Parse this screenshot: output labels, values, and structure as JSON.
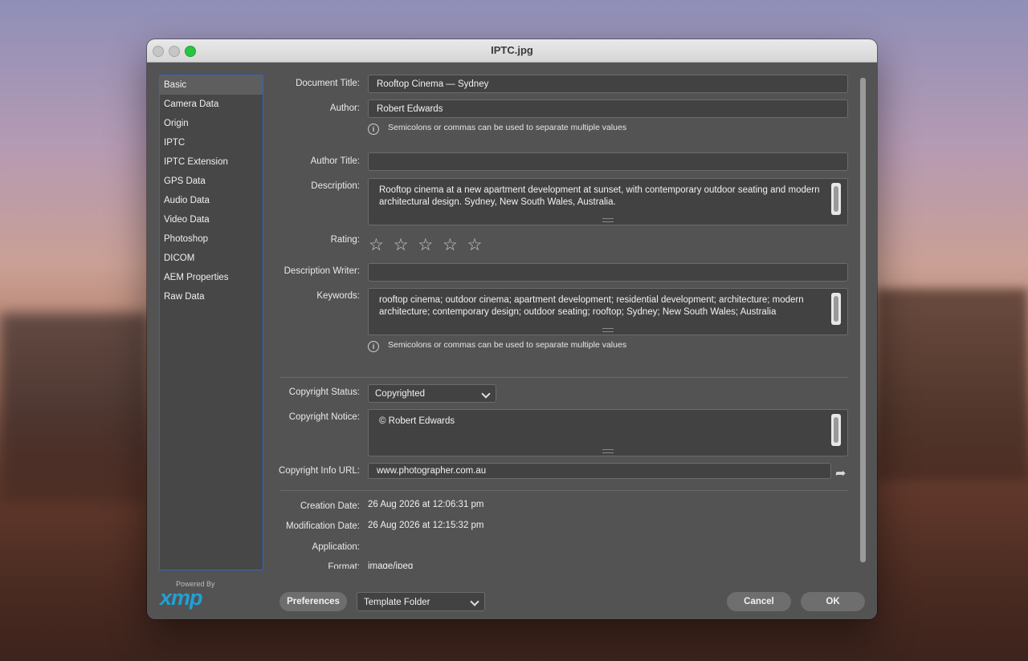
{
  "window": {
    "title": "IPTC.jpg"
  },
  "sidebar": {
    "items": [
      {
        "label": "Basic"
      },
      {
        "label": "Camera Data"
      },
      {
        "label": "Origin"
      },
      {
        "label": "IPTC"
      },
      {
        "label": "IPTC Extension"
      },
      {
        "label": "GPS Data"
      },
      {
        "label": "Audio Data"
      },
      {
        "label": "Video Data"
      },
      {
        "label": "Photoshop"
      },
      {
        "label": "DICOM"
      },
      {
        "label": "AEM Properties"
      },
      {
        "label": "Raw Data"
      }
    ],
    "active_index": 0,
    "powered_by": "Powered By",
    "brand": "xmp"
  },
  "form": {
    "document_title": {
      "label": "Document Title:",
      "value": "Rooftop Cinema — Sydney"
    },
    "author": {
      "label": "Author:",
      "value": "Robert Edwards"
    },
    "hint": "Semicolons or commas can be used to separate multiple values",
    "author_title": {
      "label": "Author Title:",
      "value": ""
    },
    "description": {
      "label": "Description:",
      "value": "Rooftop cinema at a new apartment development at sunset, with contemporary outdoor seating and modern architectural design. Sydney, New South Wales, Australia."
    },
    "rating": {
      "label": "Rating:",
      "stars": "☆ ☆ ☆ ☆ ☆",
      "value": 0,
      "max": 5
    },
    "description_writer": {
      "label": "Description Writer:",
      "value": ""
    },
    "keywords": {
      "label": "Keywords:",
      "value": "rooftop cinema; outdoor cinema; apartment development; residential development; architecture; modern architecture; contemporary design; outdoor seating; rooftop; Sydney; New South Wales; Australia"
    },
    "copyright_status": {
      "label": "Copyright Status:",
      "value": "Copyrighted"
    },
    "copyright_notice": {
      "label": "Copyright Notice:",
      "value": "© Robert Edwards"
    },
    "copyright_url": {
      "label": "Copyright Info URL:",
      "value": "www.photographer.com.au"
    },
    "creation_date": {
      "label": "Creation Date:",
      "value": "26 Aug 2026 at 12:06:31 pm"
    },
    "modification_date": {
      "label": "Modification Date:",
      "value": "26 Aug 2026 at 12:15:32 pm"
    },
    "application": {
      "label": "Application:",
      "value": ""
    },
    "format": {
      "label": "Format:",
      "value": "image/jpeg"
    }
  },
  "footer": {
    "preferences": "Preferences",
    "template_folder": "Template Folder",
    "cancel": "Cancel",
    "ok": "OK"
  },
  "icons": {
    "info": "info-icon",
    "share": "share-arrow-icon",
    "chevron": "chevron-down-icon",
    "star": "star-outline-icon"
  }
}
